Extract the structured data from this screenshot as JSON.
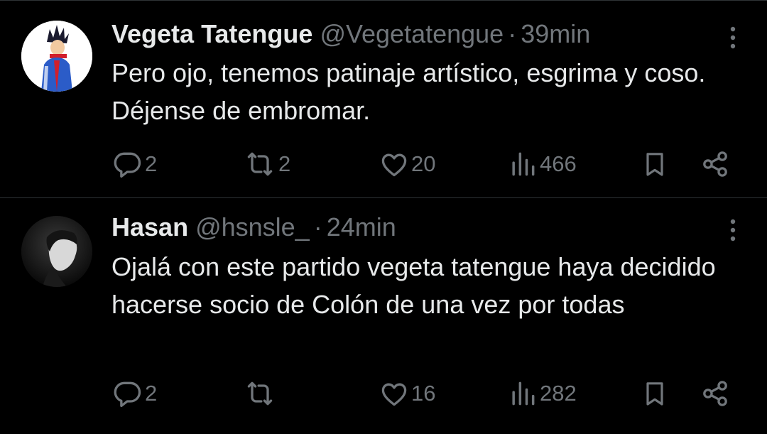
{
  "tweets": [
    {
      "name": "Vegeta Tatengue",
      "handle": "@Vegetatengue",
      "separator": "·",
      "time": "39min",
      "text": "Pero ojo, tenemos patinaje artístico, esgrima y coso. Déjense de embromar.",
      "replies": "2",
      "retweets": "2",
      "likes": "20",
      "views": "466"
    },
    {
      "name": "Hasan",
      "handle": "@hsnsle_",
      "separator": "·",
      "time": "24min",
      "text": "Ojalá con este partido vegeta tatengue haya decidido hacerse socio de Colón de una vez por todas",
      "replies": "2",
      "retweets": "",
      "likes": "16",
      "views": "282"
    }
  ],
  "icons": {
    "reply": "reply-icon",
    "retweet": "retweet-icon",
    "like": "heart-icon",
    "views": "views-icon",
    "bookmark": "bookmark-icon",
    "share": "share-icon",
    "more": "more-icon"
  },
  "colors": {
    "background": "#000000",
    "text": "#e7e9ea",
    "muted": "#71767b",
    "divider": "#2f3336"
  }
}
